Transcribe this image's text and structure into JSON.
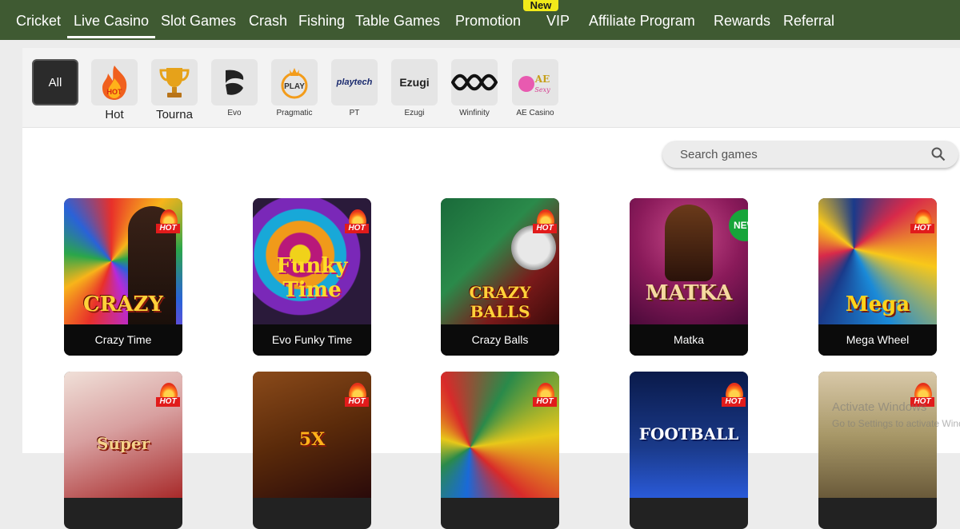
{
  "nav": {
    "items": [
      "Cricket",
      "Live Casino",
      "Slot Games",
      "Crash",
      "Fishing",
      "Table Games",
      "Promotion",
      "VIP",
      "Affiliate Program",
      "Rewards",
      "Referral"
    ],
    "active": "Live Casino",
    "new_badge": "New"
  },
  "providers": [
    {
      "label": "All",
      "icon": "all"
    },
    {
      "label": "Hot",
      "icon": "fire-icon"
    },
    {
      "label": "Tourna",
      "icon": "trophy-icon"
    },
    {
      "label": "Evo",
      "icon": "evo-logo"
    },
    {
      "label": "Pragmatic",
      "icon": "pragmatic-play-logo"
    },
    {
      "label": "PT",
      "icon": "playtech-logo"
    },
    {
      "label": "Ezugi",
      "icon": "ezugi-logo"
    },
    {
      "label": "Winfinity",
      "icon": "winfinity-logo"
    },
    {
      "label": "AE Casino",
      "icon": "ae-sexy-logo"
    }
  ],
  "logo_text": {
    "pragmatic": "PLAY",
    "playtech": "playtech",
    "ezugi": "Ezugi",
    "ae": "AE Sexy"
  },
  "search": {
    "placeholder": "Search games"
  },
  "games_row1": [
    {
      "title": "Crazy Time",
      "badge": "HOT",
      "art": "CRAZY"
    },
    {
      "title": "Evo Funky Time",
      "badge": "HOT",
      "art": "Funky Time"
    },
    {
      "title": "Crazy Balls",
      "badge": "HOT",
      "art": "CRAZY BALLS"
    },
    {
      "title": "Matka",
      "badge": "NEW",
      "art": "MATKA"
    },
    {
      "title": "Mega Wheel",
      "badge": "HOT",
      "art": "Mega"
    }
  ],
  "games_row2": [
    {
      "badge": "HOT",
      "art": "Super"
    },
    {
      "badge": "HOT",
      "art": "5X"
    },
    {
      "badge": "HOT",
      "art": ""
    },
    {
      "badge": "HOT",
      "art": "FOOTBALL"
    },
    {
      "badge": "HOT",
      "art": ""
    }
  ],
  "watermark": {
    "line1": "Activate Windows",
    "line2": "Go to Settings to activate Windows."
  },
  "colors": {
    "nav_bg": "#3f5a32",
    "new_badge": "#f2ea1a",
    "hot": "#e11b1b",
    "new_green": "#17a53a"
  }
}
